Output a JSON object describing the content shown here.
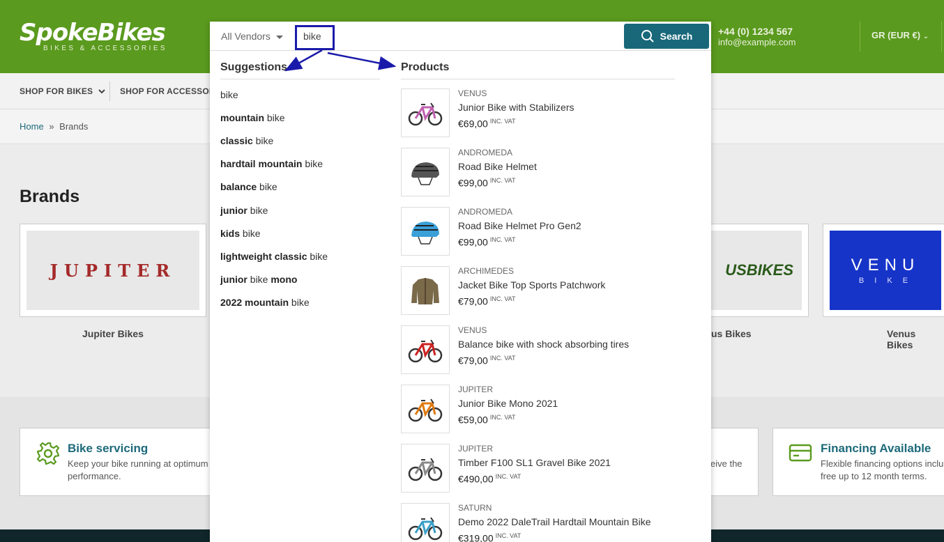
{
  "header": {
    "logo_main_a": "Spoke",
    "logo_main_b": "Bikes",
    "logo_sub": "BIKES & ACCESSORIES",
    "phone": "+44 (0) 1234 567",
    "email": "info@example.com",
    "currency": "GR (EUR €)",
    "bg_color": "#5a9a1e"
  },
  "nav": {
    "items": [
      "SHOP FOR BIKES",
      "SHOP FOR ACCESSOR"
    ]
  },
  "breadcrumb": {
    "home": "Home",
    "sep": "»",
    "current": "Brands"
  },
  "brands": {
    "title": "Brands",
    "cards": [
      {
        "logo_text": "JUPITER",
        "name": "Jupiter Bikes"
      },
      {
        "logo_text": "USBIKES",
        "name": "us Bikes"
      },
      {
        "logo_text": "VENU",
        "logo_sub": "B I K E",
        "name": "Venus Bikes"
      }
    ]
  },
  "features": [
    {
      "title": "Bike servicing",
      "text1": "Keep your bike running at optimum",
      "text2": "performance.",
      "icon": "gear-icon"
    },
    {
      "title": "",
      "text1": "eive the",
      "text2": "",
      "icon": ""
    },
    {
      "title": "Financing Available",
      "text1": "Flexible financing options inclu",
      "text2": "free up to 12 month terms.",
      "icon": "credit-card-icon"
    }
  ],
  "search": {
    "vendor": "All Vendors",
    "query": "bike",
    "button": "Search",
    "accent": "#18687a"
  },
  "suggestions": {
    "title": "Suggestions",
    "items": [
      {
        "bold": "",
        "plain": "bike"
      },
      {
        "bold": "mountain",
        "plain": " bike"
      },
      {
        "bold": "classic",
        "plain": " bike"
      },
      {
        "bold": "hardtail mountain",
        "plain": " bike"
      },
      {
        "bold": "balance",
        "plain": " bike"
      },
      {
        "bold": "junior",
        "plain": " bike"
      },
      {
        "bold": "kids",
        "plain": " bike"
      },
      {
        "bold": "lightweight classic",
        "plain": " bike"
      },
      {
        "bold": "junior",
        "plain": " bike ",
        "bold2": "mono"
      },
      {
        "bold": "2022 mountain",
        "plain": " bike"
      }
    ]
  },
  "products": {
    "title": "Products",
    "vat_label": "INC. VAT",
    "items": [
      {
        "vendor": "VENUS",
        "title": "Junior Bike with Stabilizers",
        "price": "€69,00",
        "icon": "kids-bike-icon",
        "color": "#c060b0"
      },
      {
        "vendor": "ANDROMEDA",
        "title": "Road Bike Helmet",
        "price": "€99,00",
        "icon": "helmet-icon",
        "color": "#555555"
      },
      {
        "vendor": "ANDROMEDA",
        "title": "Road Bike Helmet Pro Gen2",
        "price": "€99,00",
        "icon": "helmet-icon",
        "color": "#3aa0d8"
      },
      {
        "vendor": "ARCHIMEDES",
        "title": "Jacket Bike Top Sports Patchwork",
        "price": "€79,00",
        "icon": "jacket-icon",
        "color": "#7a6a4a"
      },
      {
        "vendor": "VENUS",
        "title": "Balance bike with shock absorbing tires",
        "price": "€79,00",
        "icon": "balance-bike-icon",
        "color": "#cc2222"
      },
      {
        "vendor": "JUPITER",
        "title": "Junior Bike Mono 2021",
        "price": "€59,00",
        "icon": "balance-bike-icon",
        "color": "#e07a10"
      },
      {
        "vendor": "JUPITER",
        "title": "Timber F100 SL1 Gravel Bike 2021",
        "price": "€490,00",
        "icon": "bike-icon",
        "color": "#888888"
      },
      {
        "vendor": "SATURN",
        "title": "Demo 2022 DaleTrail Hardtail Mountain Bike",
        "price": "€319,00",
        "icon": "bike-icon",
        "color": "#3aa0c8"
      }
    ]
  }
}
